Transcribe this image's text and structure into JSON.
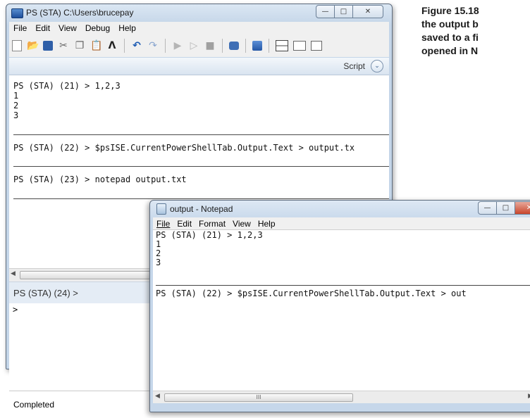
{
  "caption": {
    "lines": [
      "Figure 15.18",
      "the output b",
      "saved to a fi",
      "opened in N"
    ]
  },
  "ise": {
    "title": "PS (STA)  C:\\Users\\brucepay",
    "caption_buttons": [
      "minimize-icon",
      "maximize-icon",
      "close-icon"
    ],
    "menu": [
      "File",
      "Edit",
      "View",
      "Debug",
      "Help"
    ],
    "toolbar_icons": [
      "new-icon",
      "open-icon",
      "save-icon",
      "cut-icon",
      "copy-icon",
      "paste-icon",
      "clear-icon",
      "undo-icon",
      "redo-icon",
      "run-icon",
      "run-selection-icon",
      "stop-icon",
      "remote-tab-icon",
      "powershell-icon",
      "layout-top-icon",
      "layout-side-icon",
      "layout-max-icon"
    ],
    "script_label": "Script",
    "output_lines": [
      "PS (STA) (21) > 1,2,3",
      "1",
      "2",
      "3",
      "PS (STA) (22) > $psISE.CurrentPowerShellTab.Output.Text > output.tx",
      "PS (STA) (23) > notepad output.txt"
    ],
    "command_prompt": "PS (STA) (24) >",
    "command_input": ">",
    "status": "Completed"
  },
  "notepad": {
    "title": "output - Notepad",
    "menu": [
      "File",
      "Edit",
      "Format",
      "View",
      "Help"
    ],
    "lines": [
      "PS (STA) (21) > 1,2,3",
      "1",
      "2",
      "3",
      "PS (STA) (22) > $psISE.CurrentPowerShellTab.Output.Text > out"
    ],
    "scroll_grip": "III"
  }
}
